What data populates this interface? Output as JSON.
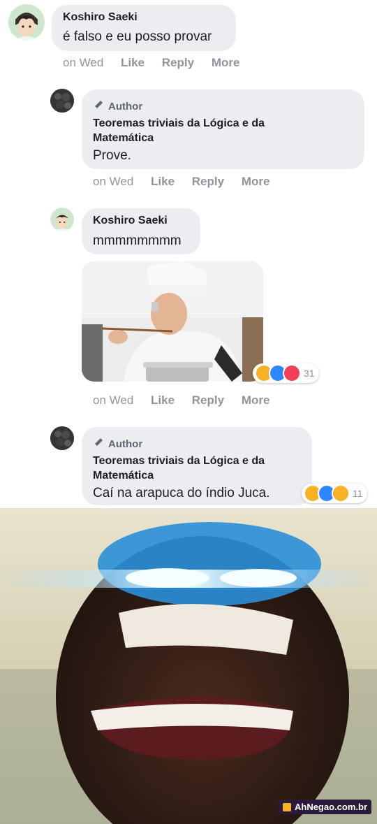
{
  "comments": [
    {
      "name": "Koshiro Saeki",
      "text": "é falso e eu posso provar",
      "meta": {
        "time": "on Wed",
        "like": "Like",
        "reply": "Reply",
        "more": "More"
      }
    },
    {
      "badge": "Author",
      "name": "Teoremas triviais da Lógica e da Matemática",
      "text": "Prove.",
      "meta": {
        "time": "on Wed",
        "like": "Like",
        "reply": "Reply",
        "more": "More"
      }
    },
    {
      "name": "Koshiro Saeki",
      "text": "mmmmmmmm",
      "reactions": {
        "count": "31"
      },
      "meta": {
        "time": "on Wed",
        "like": "Like",
        "reply": "Reply",
        "more": "More"
      }
    },
    {
      "badge": "Author",
      "name": "Teoremas triviais da Lógica e da Matemática",
      "text": "Caí na arapuca do índio Juca.",
      "reactions": {
        "count": "11"
      }
    }
  ],
  "watermark": "AhNegao.com.br",
  "colors": {
    "bubble": "#ebedf1",
    "meta": "#90949c",
    "haha": "#f7b125",
    "wow": "#2d88ff",
    "love": "#f33e58"
  }
}
